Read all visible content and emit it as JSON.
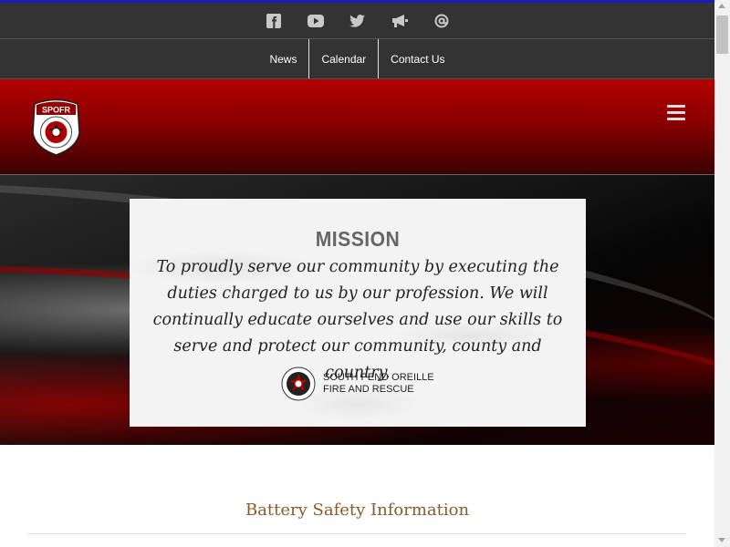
{
  "social_icons": [
    {
      "icon": "facebook-icon"
    },
    {
      "icon": "youtube-icon"
    },
    {
      "icon": "twitter-icon"
    },
    {
      "icon": "megaphone-icon"
    },
    {
      "icon": "email-at-icon"
    }
  ],
  "nav": {
    "items": [
      "News",
      "Calendar",
      "Contact Us"
    ]
  },
  "header": {
    "logo_text": "SPOFR"
  },
  "mission": {
    "title": "MISSION",
    "text": "To proudly serve our community by executing the duties charged to us by our profession. We will continually educate ourselves and use our skills to serve and protect our community, county and country.",
    "brand_line1": "SOUTH PEND OREILLE",
    "brand_line2": "FIRE AND RESCUE"
  },
  "section": {
    "title": "Battery Safety Information"
  },
  "colors": {
    "top_border": "#1a1ab8",
    "bar_bg": "#333333",
    "header_red": "#b30000",
    "section_title": "#8b5a2b"
  }
}
